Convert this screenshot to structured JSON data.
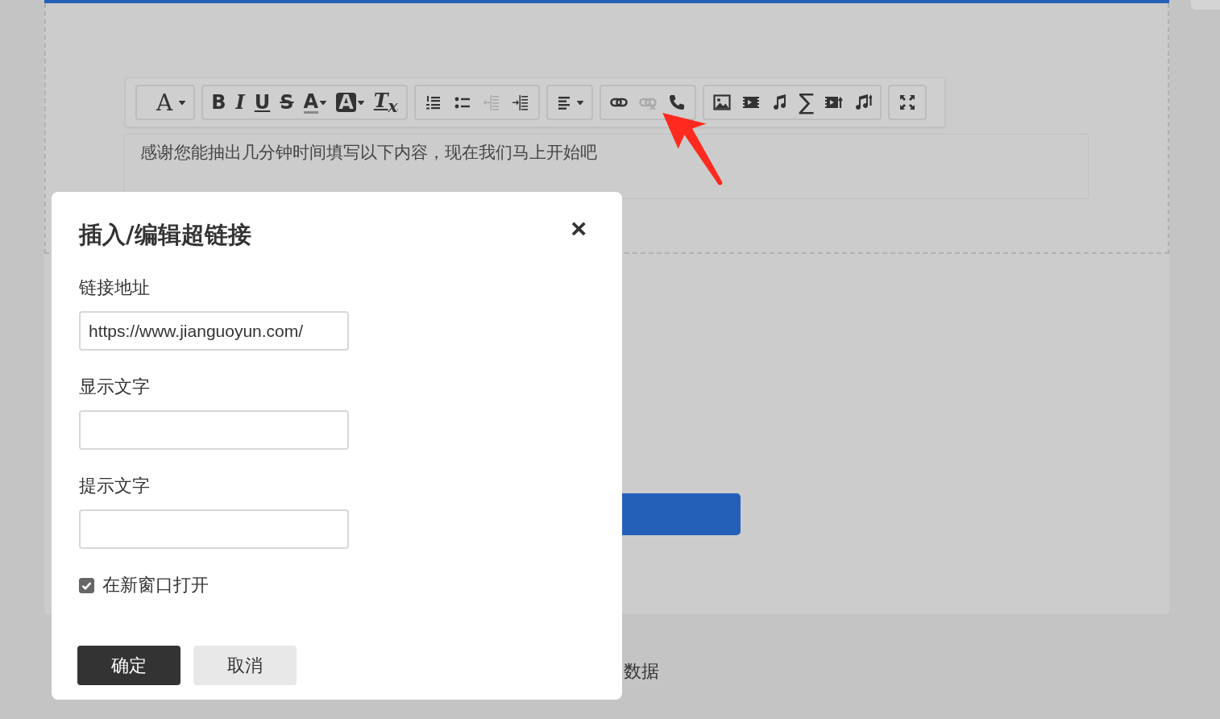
{
  "toolbar": {
    "groups": [
      {
        "buttons": [
          {
            "kind": "font",
            "glyph": "A",
            "disabled": false
          }
        ]
      },
      {
        "buttons": [
          {
            "kind": "bold",
            "glyph": "B",
            "disabled": false
          },
          {
            "kind": "italic",
            "glyph": "I",
            "disabled": false
          },
          {
            "kind": "underline",
            "glyph": "U",
            "disabled": false
          },
          {
            "kind": "strike",
            "glyph": "S",
            "disabled": false
          },
          {
            "kind": "forecolor",
            "glyph": "A",
            "disabled": false
          },
          {
            "kind": "backcolor",
            "glyph": "A",
            "disabled": false
          },
          {
            "kind": "clearformat",
            "glyph": "T$_{x}$",
            "disabled": false
          }
        ]
      },
      {
        "buttons": [
          {
            "kind": "ordered-list",
            "disabled": false
          },
          {
            "kind": "bullet-list",
            "disabled": false
          },
          {
            "kind": "outdent",
            "disabled": true
          },
          {
            "kind": "indent",
            "disabled": false
          }
        ]
      },
      {
        "buttons": [
          {
            "kind": "align",
            "disabled": false
          }
        ]
      },
      {
        "buttons": [
          {
            "kind": "link",
            "disabled": false
          },
          {
            "kind": "unlink",
            "disabled": true
          },
          {
            "kind": "phone",
            "disabled": false
          }
        ]
      },
      {
        "buttons": [
          {
            "kind": "image",
            "disabled": false
          },
          {
            "kind": "video",
            "disabled": false
          },
          {
            "kind": "music",
            "disabled": false
          },
          {
            "kind": "formula",
            "glyph": "∑",
            "disabled": false
          },
          {
            "kind": "video-upload",
            "disabled": false
          },
          {
            "kind": "music-upload",
            "disabled": false
          }
        ]
      },
      {
        "buttons": [
          {
            "kind": "fullscreen",
            "disabled": false
          }
        ]
      }
    ]
  },
  "editor": {
    "text": "感谢您能抽出几分钟时间填写以下内容，现在我们马上开始吧"
  },
  "footer": {
    "text": "数据"
  },
  "dialog": {
    "title": "插入/编辑超链接",
    "close": "×",
    "fields": [
      {
        "label": "链接地址",
        "value": "https://www.jianguoyun.com/"
      },
      {
        "label": "显示文字"
      },
      {
        "label": "提示文字"
      }
    ],
    "checkbox": {
      "label": "在新窗口打开",
      "checked": true
    },
    "buttons": [
      {
        "label": "确定",
        "kind": "primary"
      },
      {
        "label": "取消",
        "kind": "secondary"
      }
    ]
  }
}
